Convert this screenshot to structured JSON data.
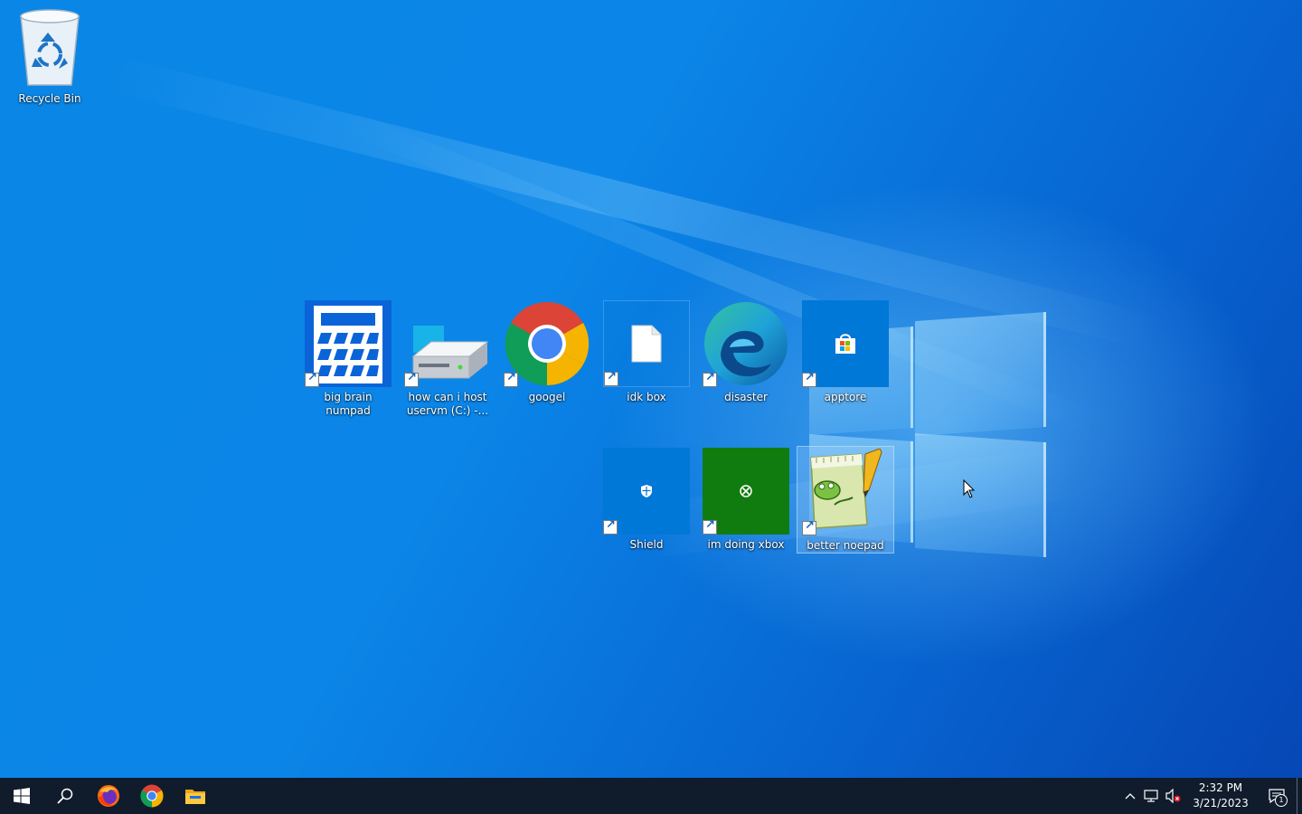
{
  "desktop": {
    "icons": [
      {
        "label": "Recycle Bin",
        "icon": "recycle-bin-icon"
      },
      {
        "label": "big brain numpad",
        "icon": "calculator-icon",
        "shortcut": true
      },
      {
        "label": "how can i host uservm (C:) -...",
        "icon": "drive-icon",
        "shortcut": true
      },
      {
        "label": "googel",
        "icon": "chrome-icon",
        "shortcut": true
      },
      {
        "label": "idk box",
        "icon": "blank-file-icon",
        "shortcut": true
      },
      {
        "label": "disaster",
        "icon": "edge-icon",
        "shortcut": true
      },
      {
        "label": "apptore",
        "icon": "store-icon",
        "shortcut": true
      },
      {
        "label": "Shield",
        "icon": "shield-icon",
        "shortcut": true
      },
      {
        "label": "im doing xbox",
        "icon": "xbox-icon",
        "shortcut": true
      },
      {
        "label": "better noepad",
        "icon": "notepad-plus-plus-icon",
        "shortcut": true,
        "selected": true
      }
    ]
  },
  "taskbar": {
    "start": "windows-start-icon",
    "search": "search-icon",
    "pinned": [
      {
        "name": "firefox",
        "icon": "firefox-icon"
      },
      {
        "name": "chrome",
        "icon": "chrome-icon"
      },
      {
        "name": "file-explorer",
        "icon": "folder-icon"
      }
    ],
    "tray": {
      "chevron": "chevron-up-icon",
      "network": "network-icon",
      "volume": "volume-muted-icon",
      "time": "2:32 PM",
      "date": "3/21/2023",
      "notification_count": "1"
    }
  },
  "colors": {
    "taskbar": "#101c2c",
    "desktop_primary": "#0a86e6",
    "xbox_green": "#107c10",
    "tile_blue": "#0078d7"
  }
}
